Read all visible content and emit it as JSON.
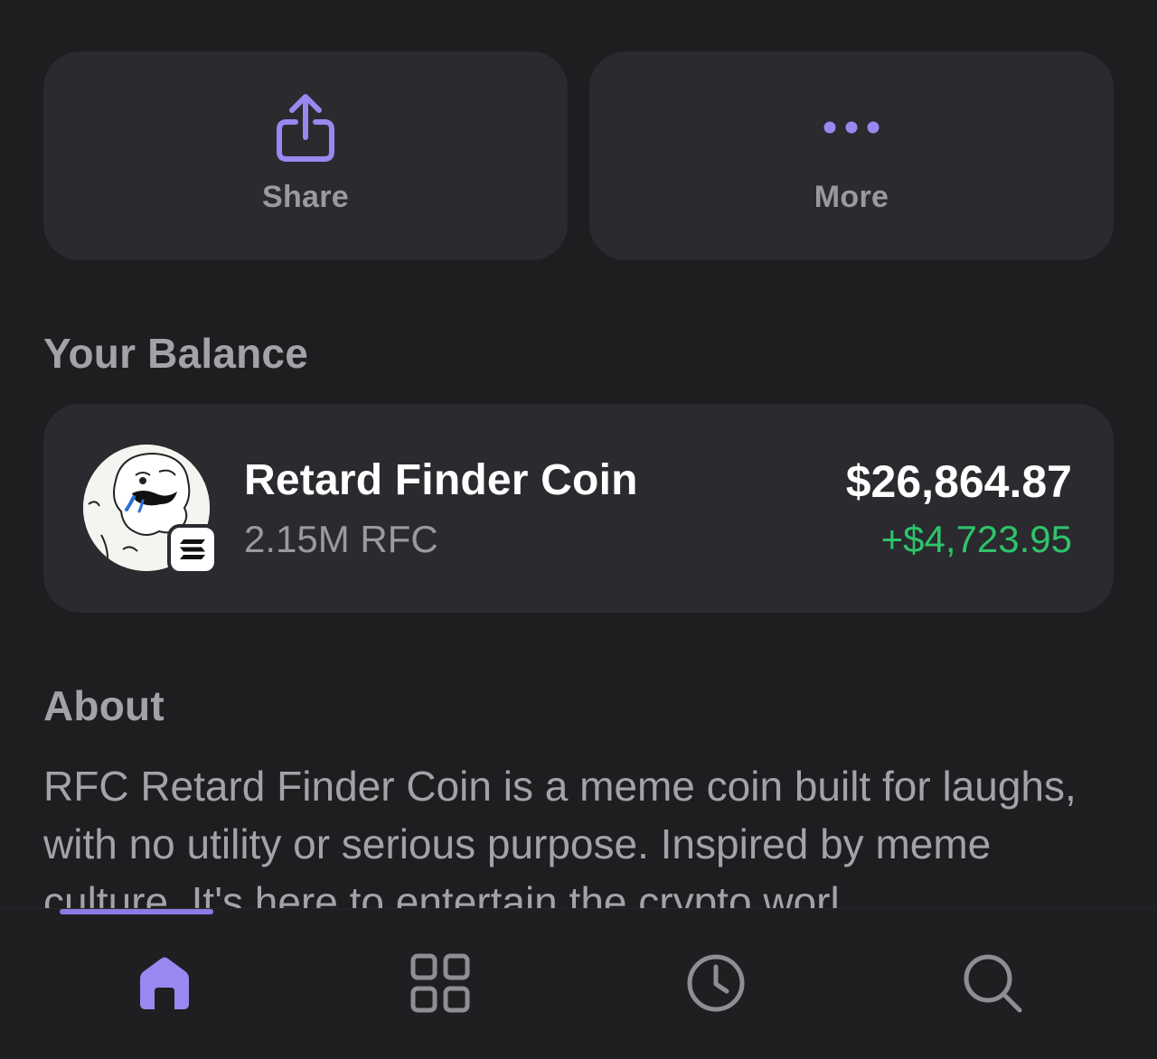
{
  "actions": {
    "share_label": "Share",
    "more_label": "More"
  },
  "balance": {
    "section_title": "Your Balance",
    "token_name": "Retard Finder Coin",
    "token_amount": "2.15M RFC",
    "value": "$26,864.87",
    "change": "+$4,723.95"
  },
  "about": {
    "section_title": "About",
    "text_before_link": "RFC Retard Finder Coin is a meme coin built for laughs, with no utility or serious purpose. Inspired by ",
    "link_text": "meme culture",
    "text_after_link": ". It's here to entertain the crypto worl"
  },
  "tab_bar": {
    "tabs": [
      {
        "icon": "home-icon",
        "active": true
      },
      {
        "icon": "grid-icon",
        "active": false
      },
      {
        "icon": "clock-icon",
        "active": false
      },
      {
        "icon": "search-icon",
        "active": false
      }
    ]
  },
  "colors": {
    "accent": "#9a87ef",
    "positive": "#2ec46a",
    "card_bg": "#2a2a2f",
    "page_bg": "#1e1e20"
  }
}
